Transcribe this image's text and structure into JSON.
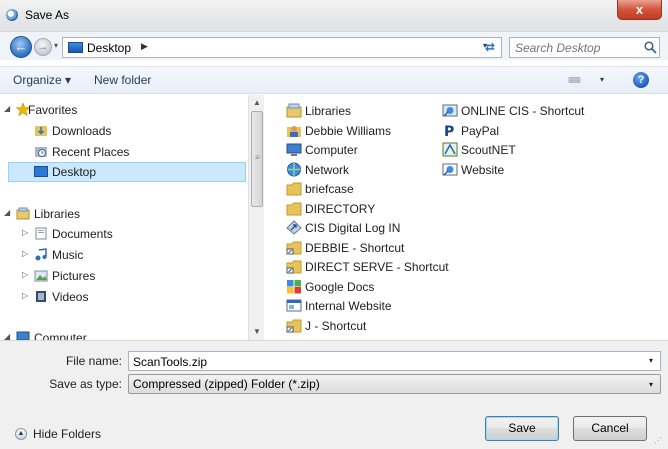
{
  "window": {
    "title": "Save As",
    "close_label": "x"
  },
  "navigation": {
    "back_label": "←",
    "forward_label": "→",
    "history_drop": "▾",
    "address": {
      "location": "Desktop",
      "separator": "▶",
      "drop": "▾"
    },
    "refresh_label": "⇄",
    "search": {
      "placeholder": "Search Desktop",
      "value": ""
    }
  },
  "toolbar": {
    "organize_label": "Organize ▾",
    "new_folder_label": "New folder",
    "view_label": "≡≡",
    "view_drop": "▾",
    "help_label": "?"
  },
  "nav_pane": {
    "favorites": {
      "label": "Favorites",
      "expander": "◢"
    },
    "favorites_items": [
      {
        "label": "Downloads",
        "icon": "downloads-folder-icon"
      },
      {
        "label": "Recent Places",
        "icon": "recent-places-icon"
      },
      {
        "label": "Desktop",
        "icon": "desktop-icon",
        "selected": true
      }
    ],
    "libraries": {
      "label": "Libraries",
      "expander": "◢"
    },
    "libraries_items": [
      {
        "label": "Documents",
        "icon": "documents-icon",
        "expander": "▷"
      },
      {
        "label": "Music",
        "icon": "music-icon",
        "expander": "▷"
      },
      {
        "label": "Pictures",
        "icon": "pictures-icon",
        "expander": "▷"
      },
      {
        "label": "Videos",
        "icon": "videos-icon",
        "expander": "▷"
      }
    ],
    "computer": {
      "label": "Computer",
      "expander": "◢"
    }
  },
  "scrollbar": {
    "up": "▲",
    "down": "▼",
    "grip": "≡"
  },
  "files": {
    "column1": [
      {
        "label": "Libraries",
        "icon": "libraries-icon"
      },
      {
        "label": "Debbie Williams",
        "icon": "user-folder-icon"
      },
      {
        "label": "Computer",
        "icon": "computer-icon"
      },
      {
        "label": "Network",
        "icon": "network-icon"
      },
      {
        "label": "briefcase",
        "icon": "folder-icon"
      },
      {
        "label": "DIRECTORY",
        "icon": "folder-icon"
      },
      {
        "label": "CIS Digital Log IN",
        "icon": "shortcut-icon"
      },
      {
        "label": "DEBBIE - Shortcut",
        "icon": "shortcut-folder-icon"
      },
      {
        "label": "DIRECT SERVE - Shortcut",
        "icon": "shortcut-folder-icon"
      },
      {
        "label": "Google Docs",
        "icon": "google-docs-icon"
      },
      {
        "label": "Internal Website",
        "icon": "website-icon"
      },
      {
        "label": "J - Shortcut",
        "icon": "shortcut-folder-icon"
      }
    ],
    "column2": [
      {
        "label": "ONLINE CIS - Shortcut",
        "icon": "shortcut-icon"
      },
      {
        "label": "PayPal",
        "icon": "paypal-icon"
      },
      {
        "label": "ScoutNET",
        "icon": "scoutnet-icon"
      },
      {
        "label": "Website",
        "icon": "website-icon"
      }
    ]
  },
  "save_form": {
    "file_name_label": "File name:",
    "file_name_value": "ScanTools.zip",
    "save_as_type_label": "Save as type:",
    "save_as_type_value": "Compressed (zipped) Folder (*.zip)",
    "drop": "▾"
  },
  "footer": {
    "hide_folders_label": "Hide Folders",
    "hide_folders_icon": "▲",
    "save_label": "Save",
    "cancel_label": "Cancel",
    "resize_grip": "⋰"
  },
  "colors": {
    "selection": "#cce8ff",
    "link_text": "#1e395b",
    "close_button": "#c13b22",
    "accent_blue": "#2b6fbf"
  }
}
